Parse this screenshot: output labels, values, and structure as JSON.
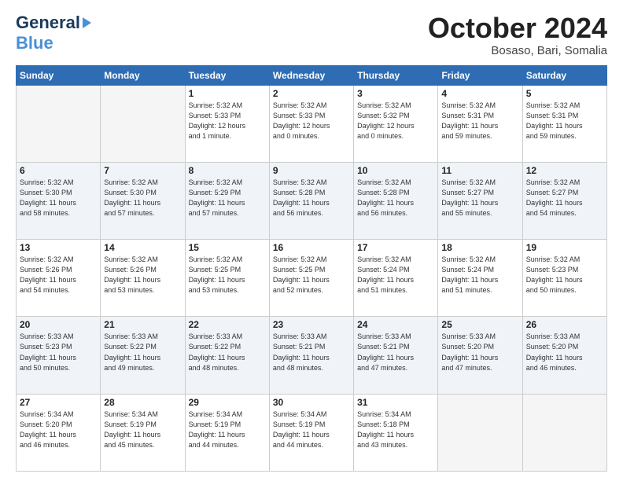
{
  "logo": {
    "line1": "General",
    "line2": "Blue"
  },
  "header": {
    "month": "October 2024",
    "location": "Bosaso, Bari, Somalia"
  },
  "weekdays": [
    "Sunday",
    "Monday",
    "Tuesday",
    "Wednesday",
    "Thursday",
    "Friday",
    "Saturday"
  ],
  "weeks": [
    [
      {
        "day": "",
        "info": ""
      },
      {
        "day": "",
        "info": ""
      },
      {
        "day": "1",
        "info": "Sunrise: 5:32 AM\nSunset: 5:33 PM\nDaylight: 12 hours\nand 1 minute."
      },
      {
        "day": "2",
        "info": "Sunrise: 5:32 AM\nSunset: 5:33 PM\nDaylight: 12 hours\nand 0 minutes."
      },
      {
        "day": "3",
        "info": "Sunrise: 5:32 AM\nSunset: 5:32 PM\nDaylight: 12 hours\nand 0 minutes."
      },
      {
        "day": "4",
        "info": "Sunrise: 5:32 AM\nSunset: 5:31 PM\nDaylight: 11 hours\nand 59 minutes."
      },
      {
        "day": "5",
        "info": "Sunrise: 5:32 AM\nSunset: 5:31 PM\nDaylight: 11 hours\nand 59 minutes."
      }
    ],
    [
      {
        "day": "6",
        "info": "Sunrise: 5:32 AM\nSunset: 5:30 PM\nDaylight: 11 hours\nand 58 minutes."
      },
      {
        "day": "7",
        "info": "Sunrise: 5:32 AM\nSunset: 5:30 PM\nDaylight: 11 hours\nand 57 minutes."
      },
      {
        "day": "8",
        "info": "Sunrise: 5:32 AM\nSunset: 5:29 PM\nDaylight: 11 hours\nand 57 minutes."
      },
      {
        "day": "9",
        "info": "Sunrise: 5:32 AM\nSunset: 5:28 PM\nDaylight: 11 hours\nand 56 minutes."
      },
      {
        "day": "10",
        "info": "Sunrise: 5:32 AM\nSunset: 5:28 PM\nDaylight: 11 hours\nand 56 minutes."
      },
      {
        "day": "11",
        "info": "Sunrise: 5:32 AM\nSunset: 5:27 PM\nDaylight: 11 hours\nand 55 minutes."
      },
      {
        "day": "12",
        "info": "Sunrise: 5:32 AM\nSunset: 5:27 PM\nDaylight: 11 hours\nand 54 minutes."
      }
    ],
    [
      {
        "day": "13",
        "info": "Sunrise: 5:32 AM\nSunset: 5:26 PM\nDaylight: 11 hours\nand 54 minutes."
      },
      {
        "day": "14",
        "info": "Sunrise: 5:32 AM\nSunset: 5:26 PM\nDaylight: 11 hours\nand 53 minutes."
      },
      {
        "day": "15",
        "info": "Sunrise: 5:32 AM\nSunset: 5:25 PM\nDaylight: 11 hours\nand 53 minutes."
      },
      {
        "day": "16",
        "info": "Sunrise: 5:32 AM\nSunset: 5:25 PM\nDaylight: 11 hours\nand 52 minutes."
      },
      {
        "day": "17",
        "info": "Sunrise: 5:32 AM\nSunset: 5:24 PM\nDaylight: 11 hours\nand 51 minutes."
      },
      {
        "day": "18",
        "info": "Sunrise: 5:32 AM\nSunset: 5:24 PM\nDaylight: 11 hours\nand 51 minutes."
      },
      {
        "day": "19",
        "info": "Sunrise: 5:32 AM\nSunset: 5:23 PM\nDaylight: 11 hours\nand 50 minutes."
      }
    ],
    [
      {
        "day": "20",
        "info": "Sunrise: 5:33 AM\nSunset: 5:23 PM\nDaylight: 11 hours\nand 50 minutes."
      },
      {
        "day": "21",
        "info": "Sunrise: 5:33 AM\nSunset: 5:22 PM\nDaylight: 11 hours\nand 49 minutes."
      },
      {
        "day": "22",
        "info": "Sunrise: 5:33 AM\nSunset: 5:22 PM\nDaylight: 11 hours\nand 48 minutes."
      },
      {
        "day": "23",
        "info": "Sunrise: 5:33 AM\nSunset: 5:21 PM\nDaylight: 11 hours\nand 48 minutes."
      },
      {
        "day": "24",
        "info": "Sunrise: 5:33 AM\nSunset: 5:21 PM\nDaylight: 11 hours\nand 47 minutes."
      },
      {
        "day": "25",
        "info": "Sunrise: 5:33 AM\nSunset: 5:20 PM\nDaylight: 11 hours\nand 47 minutes."
      },
      {
        "day": "26",
        "info": "Sunrise: 5:33 AM\nSunset: 5:20 PM\nDaylight: 11 hours\nand 46 minutes."
      }
    ],
    [
      {
        "day": "27",
        "info": "Sunrise: 5:34 AM\nSunset: 5:20 PM\nDaylight: 11 hours\nand 46 minutes."
      },
      {
        "day": "28",
        "info": "Sunrise: 5:34 AM\nSunset: 5:19 PM\nDaylight: 11 hours\nand 45 minutes."
      },
      {
        "day": "29",
        "info": "Sunrise: 5:34 AM\nSunset: 5:19 PM\nDaylight: 11 hours\nand 44 minutes."
      },
      {
        "day": "30",
        "info": "Sunrise: 5:34 AM\nSunset: 5:19 PM\nDaylight: 11 hours\nand 44 minutes."
      },
      {
        "day": "31",
        "info": "Sunrise: 5:34 AM\nSunset: 5:18 PM\nDaylight: 11 hours\nand 43 minutes."
      },
      {
        "day": "",
        "info": ""
      },
      {
        "day": "",
        "info": ""
      }
    ]
  ]
}
